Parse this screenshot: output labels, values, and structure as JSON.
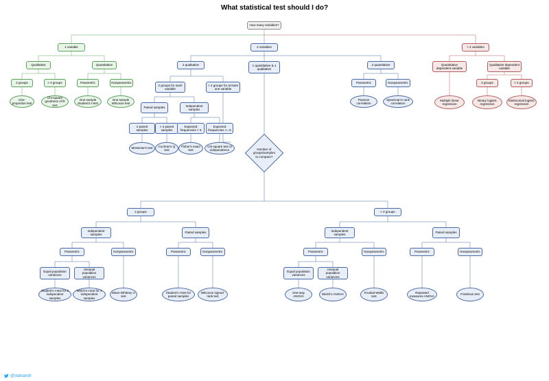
{
  "title": "What statistical test should I do?",
  "footer": {
    "handle": "@statsandr"
  },
  "nodes": {
    "root": "How many variables?",
    "v1": "1 variable",
    "v1_qual": "Qualitative",
    "v1_quant": "Quantitative",
    "v1_2g": "2 groups",
    "v1_gt2g": "> 2 groups",
    "v1_param": "Parametric",
    "v1_nonparam": "Nonparametric",
    "t_oneprop": "One-proportion test",
    "t_chisq_gof": "Chi-square goodness of fit test",
    "t_onesample_t": "One-sample Student's t-test",
    "t_onesample_wil": "One-sample Wilcoxon test",
    "v2": "2 variables",
    "v2_2qual": "2 qualitative",
    "v2_1q1q": "1 quantitative & 1 qualitative",
    "v2_2quant": "2 quantitative",
    "v2_2g_each": "2 groups for each variable",
    "v2_gt2g_atleast": "> 2 groups for at least one variable",
    "v2_paired": "Paired samples",
    "v2_indep": "Independent samples",
    "v2_2ps": "2 paired samples",
    "v2_gt2ps": "> 2 paired samples",
    "v2_ef_lt5": "Expected frequencies < 5",
    "v2_ef_ge5": "Expected frequencies >= 5",
    "t_mcnemar": "McNemar's test",
    "t_cochran": "Cochran's Q test",
    "t_fisher": "Fisher's exact test",
    "t_chisq_ind": "Chi-square test of independence",
    "v2q_param": "Parametric",
    "v2q_nonparam": "Nonparametric",
    "t_pearson": "Pearson correlation",
    "t_spearman": "Spearman's rank correlation",
    "numgroups": "Number of groups/samples to compare?",
    "g2": "2 groups",
    "ggt2": "> 2 groups",
    "g2_indep": "Independent samples",
    "g2_paired": "Paired samples",
    "g2i_param": "Parametric",
    "g2i_nonparam": "Nonparametric",
    "g2p_param": "Parametric",
    "g2p_nonparam": "Nonparametric",
    "g2i_eqvar": "Equal population variances",
    "g2i_uneqvar": "Unequal population variances",
    "t_student2": "Student's t-test for 2 independent samples",
    "t_welch2": "Welch's t-test for 2 independent samples",
    "t_mannwhit": "Mann-Whitney U test",
    "t_studentpaired": "Student's t-test for paired samples",
    "t_wilcoxon_sr": "Wilcoxon signed-rank test",
    "ggt2_indep": "Independent samples",
    "ggt2_paired": "Paired samples",
    "ggt2i_param": "Parametric",
    "ggt2i_nonparam": "Nonparametric",
    "ggt2p_param": "Parametric",
    "ggt2p_nonparam": "Nonparametric",
    "ggt2i_eqvar": "Equal population variances",
    "ggt2i_uneqvar": "Unequal population variances",
    "t_anova1": "One-way ANOVA",
    "t_welch_anova": "Welch's ANOVA",
    "t_kruskal": "Kruskal-Wallis test",
    "t_rmanova": "Repeated measures ANOVA",
    "t_friedman": "Friedman test",
    "vgt2": "> 2 variables",
    "vgt2_quant": "Quantitative dependent variable",
    "vgt2_qual": "Qualitative dependent variable",
    "vgt2_2g": "2 groups",
    "vgt2_gt2g": "> 2 groups",
    "t_mlr": "Multiple linear regression",
    "t_binlog": "Binary logistic regression",
    "t_multilog": "Multinomial logistic regression"
  }
}
